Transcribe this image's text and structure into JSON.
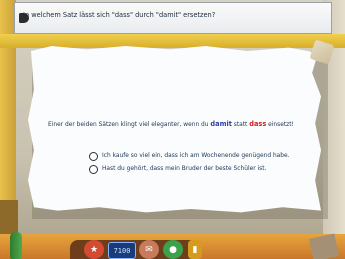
{
  "question": {
    "text": "In welchem Satz lässt sich \"dass\" durch \"damit\" ersetzen?"
  },
  "instruction": {
    "before": "Einer der beiden Sätzen klingt viel eleganter, wenn du",
    "word_blue": "damit",
    "middle": "statt",
    "word_red": "dass",
    "after": "einsetzt!"
  },
  "options": [
    "Ich kaufe so viel ein, dass ich am Wochenende genügend habe.",
    "Hast du gehört, dass mein Bruder der beste Schüler ist."
  ],
  "toolbar": {
    "score": "7100",
    "star_glyph": "★",
    "map_glyph": "✉",
    "globe_glyph": "●",
    "book_glyph": "▮"
  },
  "colors": {
    "highlight_blue": "#2b3fa6",
    "highlight_red": "#d02020",
    "question_text": "#1b2a3a"
  }
}
